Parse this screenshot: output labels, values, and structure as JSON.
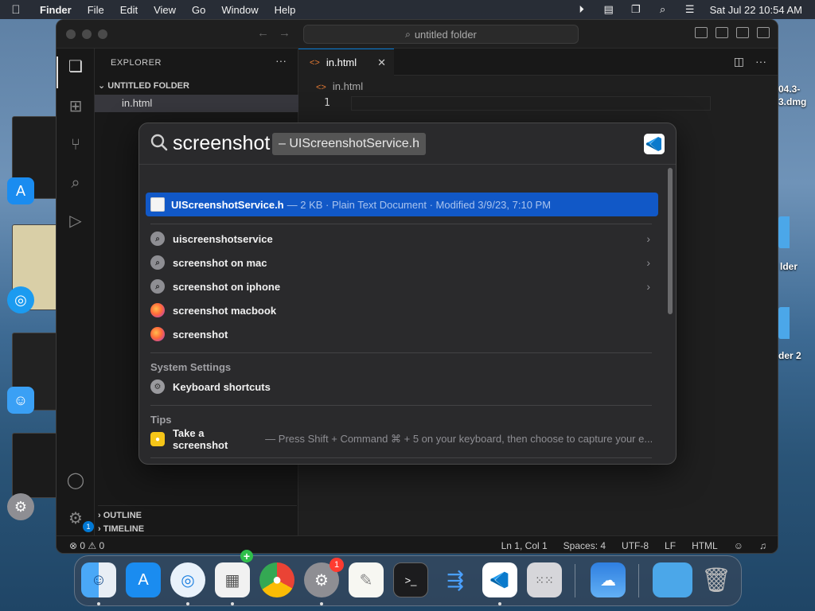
{
  "menubar": {
    "app": "Finder",
    "items": [
      "File",
      "Edit",
      "View",
      "Go",
      "Window",
      "Help"
    ],
    "clock": "Sat Jul 22  10:54 AM",
    "status_icons": [
      "play-circle-icon",
      "stage-manager-icon",
      "screen-mirroring-icon",
      "search-icon",
      "control-center-icon"
    ]
  },
  "desktop": {
    "right_labels": [
      "04.3-",
      "3.dmg",
      "lder",
      "der 2"
    ]
  },
  "vscode": {
    "title": "untitled folder",
    "sidebar": {
      "title": "EXPLORER",
      "folder": "UNTITLED FOLDER",
      "file": "in.html",
      "outline": "OUTLINE",
      "timeline": "TIMELINE"
    },
    "tab": {
      "label": "in.html"
    },
    "breadcrumb": "in.html",
    "line_number": "1",
    "settings_badge": "1",
    "status": {
      "problems": "⊗ 0 ⚠ 0",
      "position": "Ln 1, Col 1",
      "spaces": "Spaces: 4",
      "encoding": "UTF-8",
      "eol": "LF",
      "language": "HTML"
    }
  },
  "spotlight": {
    "query": "screenshot",
    "suggestion": "– UIScreenshotService.h",
    "top_hit": {
      "name": "UIScreenshotService.h",
      "detail": "— 2 KB · Plain Text Document · Modified 3/9/23, 7:10 PM"
    },
    "suggestions": [
      {
        "label": "uiscreenshotservice",
        "kind": "search"
      },
      {
        "label": "screenshot on mac",
        "kind": "search"
      },
      {
        "label": "screenshot on iphone",
        "kind": "search"
      },
      {
        "label": "screenshot macbook",
        "kind": "firefox"
      },
      {
        "label": "screenshot",
        "kind": "firefox"
      }
    ],
    "system_settings": {
      "header": "System Settings",
      "item": "Keyboard shortcuts"
    },
    "tips": {
      "header": "Tips",
      "title": "Take a screenshot",
      "detail": "— Press Shift + Command ⌘ + 5 on your keyboard, then choose to capture your e..."
    }
  },
  "dock": {
    "settings_badge": "1",
    "apps": [
      "Finder",
      "App Store",
      "Safari",
      "Preview",
      "Chrome",
      "System Settings",
      "TextEdit",
      "Terminal",
      "Xcode Instruments",
      "Visual Studio Code",
      "Launchpad",
      "Weather",
      "Folder",
      "Trash"
    ]
  },
  "colors": {
    "accent": "#0078d4",
    "spotlight_highlight": "#1158c7",
    "badge_red": "#ff3b30"
  }
}
